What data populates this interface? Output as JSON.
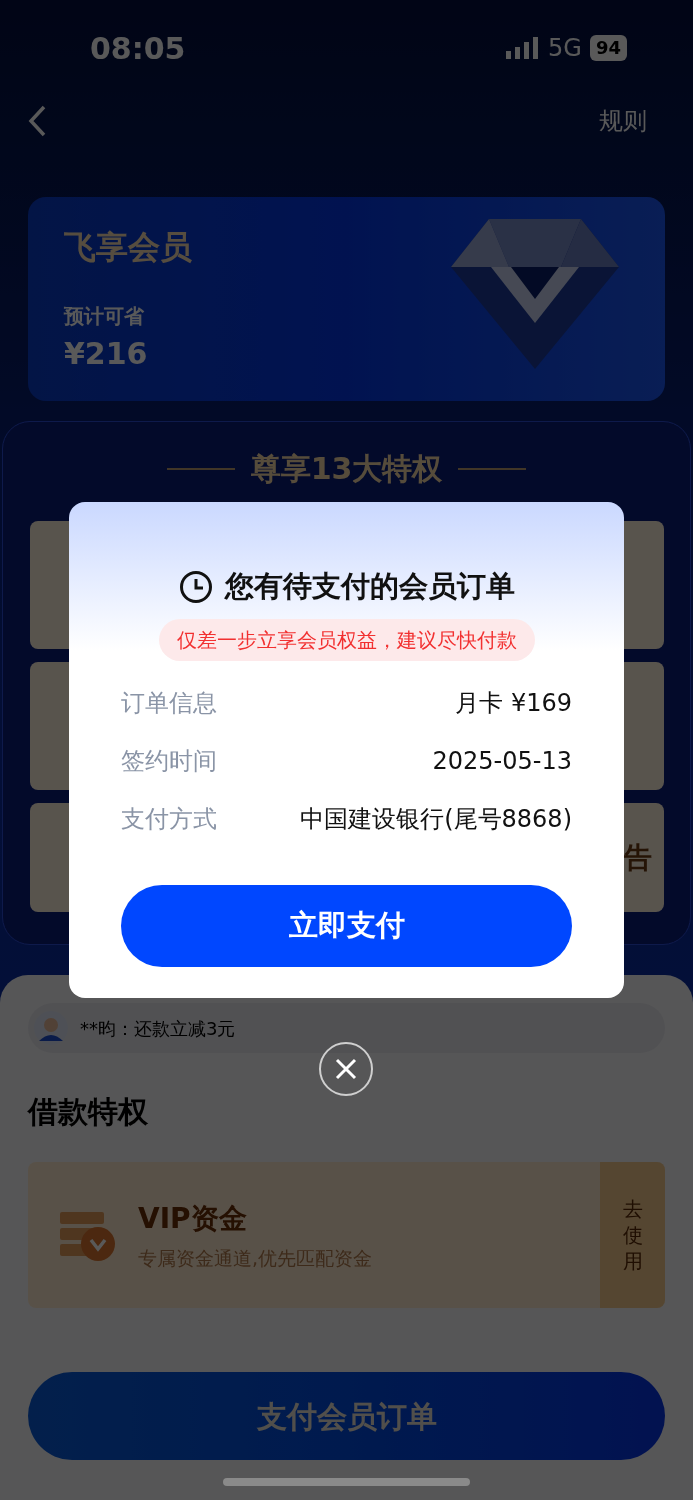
{
  "status_bar": {
    "time": "08:05",
    "network": "5G",
    "battery": "94"
  },
  "nav": {
    "action": "规则"
  },
  "member_card": {
    "title": "飞享会员",
    "savings_label": "预计可省",
    "savings": "¥216"
  },
  "privileges": {
    "title": "尊享13大特权",
    "cut_tile_label": "告"
  },
  "ticker": {
    "text": "**昀：还款立减3元"
  },
  "loan_section": {
    "title": "借款特权",
    "cards": [
      {
        "title": "VIP资金",
        "subtitle": "专属资金通道,优先匹配资金",
        "action": "去使用"
      }
    ]
  },
  "pay_button": "支付会员订单",
  "dialog": {
    "title": "您有待支付的会员订单",
    "notice": "仅差一步立享会员权益，建议尽快付款",
    "rows": [
      {
        "label": "订单信息",
        "value": "月卡 ¥169"
      },
      {
        "label": "签约时间",
        "value": "2025-05-13"
      },
      {
        "label": "支付方式",
        "value": "中国建设银行(尾号8868)"
      }
    ],
    "button": "立即支付"
  }
}
